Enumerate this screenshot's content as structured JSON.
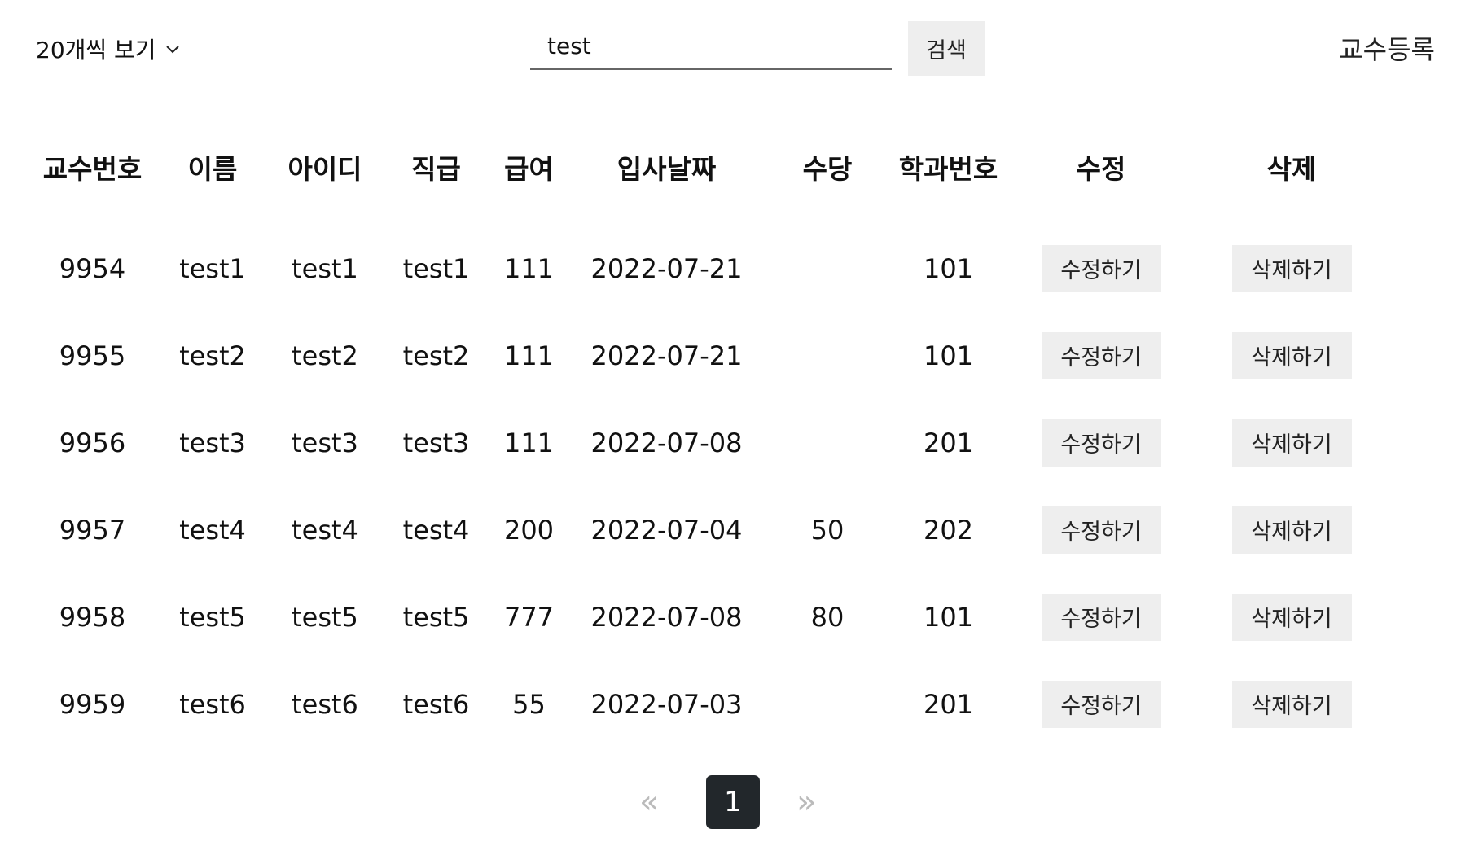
{
  "toolbar": {
    "per_page_label": "20개씩 보기",
    "search_value": "test",
    "search_button_label": "검색",
    "register_label": "교수등록"
  },
  "table": {
    "headers": [
      "교수번호",
      "이름",
      "아이디",
      "직급",
      "급여",
      "입사날짜",
      "수당",
      "학과번호",
      "수정",
      "삭제"
    ],
    "rows": [
      {
        "id": "9954",
        "name": "test1",
        "userid": "test1",
        "position": "test1",
        "salary": "111",
        "hiredate": "2022-07-21",
        "allowance": "",
        "dept": "101",
        "edit": "수정하기",
        "delete": "삭제하기"
      },
      {
        "id": "9955",
        "name": "test2",
        "userid": "test2",
        "position": "test2",
        "salary": "111",
        "hiredate": "2022-07-21",
        "allowance": "",
        "dept": "101",
        "edit": "수정하기",
        "delete": "삭제하기"
      },
      {
        "id": "9956",
        "name": "test3",
        "userid": "test3",
        "position": "test3",
        "salary": "111",
        "hiredate": "2022-07-08",
        "allowance": "",
        "dept": "201",
        "edit": "수정하기",
        "delete": "삭제하기"
      },
      {
        "id": "9957",
        "name": "test4",
        "userid": "test4",
        "position": "test4",
        "salary": "200",
        "hiredate": "2022-07-04",
        "allowance": "50",
        "dept": "202",
        "edit": "수정하기",
        "delete": "삭제하기"
      },
      {
        "id": "9958",
        "name": "test5",
        "userid": "test5",
        "position": "test5",
        "salary": "777",
        "hiredate": "2022-07-08",
        "allowance": "80",
        "dept": "101",
        "edit": "수정하기",
        "delete": "삭제하기"
      },
      {
        "id": "9959",
        "name": "test6",
        "userid": "test6",
        "position": "test6",
        "salary": "55",
        "hiredate": "2022-07-03",
        "allowance": "",
        "dept": "201",
        "edit": "수정하기",
        "delete": "삭제하기"
      }
    ]
  },
  "pagination": {
    "prev_icon": "«",
    "current_page": "1",
    "next_icon": "»"
  },
  "icons": {
    "per_page_dropdown": "chevron-down-icon",
    "prev": "double-chevron-left-icon",
    "next": "double-chevron-right-icon"
  },
  "colors": {
    "button_bg": "#eeeeee",
    "active_page_bg": "#22272b",
    "pager_arrow": "#bbbbbb"
  }
}
